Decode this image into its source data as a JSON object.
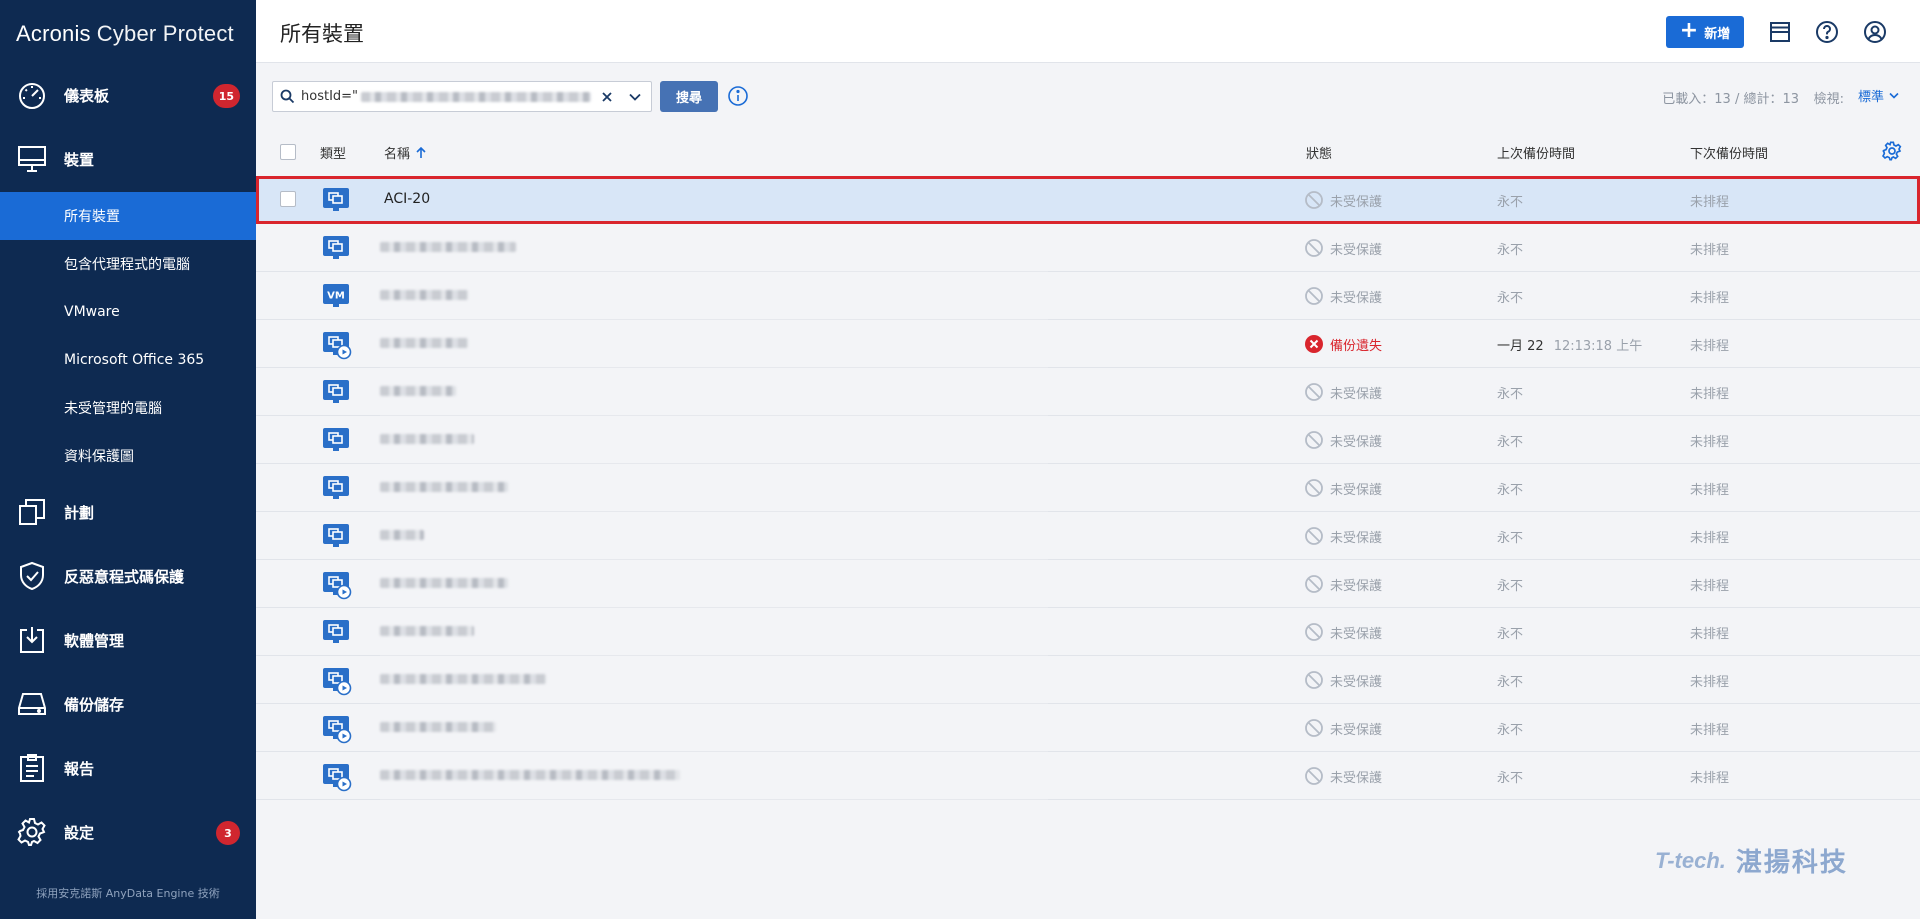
{
  "app": {
    "brand_primary": "Acronis",
    "brand_secondary": "Cyber Protect",
    "footer": "採用安克諾斯 AnyData Engine 技術"
  },
  "sidebar": {
    "main": [
      {
        "id": "dashboard",
        "label": "儀表板",
        "icon": "dashboard-gauge-icon",
        "badge": "15"
      },
      {
        "id": "devices",
        "label": "裝置",
        "icon": "monitor-icon"
      },
      {
        "id": "plans",
        "label": "計劃",
        "icon": "plans-icon"
      },
      {
        "id": "antimalware",
        "label": "反惡意程式碼保護",
        "icon": "shield-check-icon"
      },
      {
        "id": "software",
        "label": "軟體管理",
        "icon": "software-download-icon"
      },
      {
        "id": "storage",
        "label": "備份儲存",
        "icon": "storage-drive-icon"
      },
      {
        "id": "reports",
        "label": "報告",
        "icon": "report-clipboard-icon"
      },
      {
        "id": "settings",
        "label": "設定",
        "icon": "gear-icon",
        "badge": "3"
      }
    ],
    "sub": [
      {
        "label": "所有裝置",
        "active": true
      },
      {
        "label": "包含代理程式的電腦"
      },
      {
        "label": "VMware"
      },
      {
        "label": "Microsoft Office 365"
      },
      {
        "label": "未受管理的電腦"
      },
      {
        "label": "資料保護圖"
      }
    ]
  },
  "header": {
    "title": "所有裝置",
    "add_label": "新增",
    "icons": [
      "layout-toggle-icon",
      "help-icon",
      "user-account-icon"
    ]
  },
  "toolbar": {
    "search_value": "hostId=\"",
    "search_button": "搜尋",
    "loaded_text": "已載入：13 / 總計：13",
    "view_label": "檢視:",
    "view_value": "標準"
  },
  "table": {
    "columns": {
      "type": "類型",
      "name": "名稱",
      "status": "狀態",
      "last_backup": "上次備份時間",
      "next_backup": "下次備份時間"
    },
    "sort_column": "name",
    "sort_direction": "ascending",
    "rows": [
      {
        "type": "machine",
        "name": "ACI-20",
        "status": "未受保護",
        "status_kind": "unprotected",
        "last": "永不",
        "next": "未排程",
        "selected": true
      },
      {
        "type": "machine",
        "name": "",
        "status": "未受保護",
        "status_kind": "unprotected",
        "last": "永不",
        "next": "未排程"
      },
      {
        "type": "vm",
        "name": "",
        "status": "未受保護",
        "status_kind": "unprotected",
        "last": "永不",
        "next": "未排程"
      },
      {
        "type": "machine-agent",
        "name": "",
        "status": "備份遺失",
        "status_kind": "error",
        "last": "一月 22",
        "last_time": "12:13:18 上午",
        "next": "未排程"
      },
      {
        "type": "machine",
        "name": "",
        "status": "未受保護",
        "status_kind": "unprotected",
        "last": "永不",
        "next": "未排程"
      },
      {
        "type": "machine",
        "name": "",
        "status": "未受保護",
        "status_kind": "unprotected",
        "last": "永不",
        "next": "未排程"
      },
      {
        "type": "machine",
        "name": "",
        "status": "未受保護",
        "status_kind": "unprotected",
        "last": "永不",
        "next": "未排程"
      },
      {
        "type": "machine",
        "name": "",
        "status": "未受保護",
        "status_kind": "unprotected",
        "last": "永不",
        "next": "未排程"
      },
      {
        "type": "machine-agent",
        "name": "",
        "status": "未受保護",
        "status_kind": "unprotected",
        "last": "永不",
        "next": "未排程"
      },
      {
        "type": "machine",
        "name": "",
        "status": "未受保護",
        "status_kind": "unprotected",
        "last": "永不",
        "next": "未排程"
      },
      {
        "type": "machine-agent",
        "name": "",
        "status": "未受保護",
        "status_kind": "unprotected",
        "last": "永不",
        "next": "未排程"
      },
      {
        "type": "machine-agent",
        "name": "",
        "status": "未受保護",
        "status_kind": "unprotected",
        "last": "永不",
        "next": "未排程"
      },
      {
        "type": "machine-agent",
        "name": "",
        "status": "未受保護",
        "status_kind": "unprotected",
        "last": "永不",
        "next": "未排程"
      }
    ]
  },
  "watermark": {
    "logo": "T-tech.",
    "name": "湛揚科技"
  },
  "colors": {
    "sidebar_bg": "#0e2a51",
    "accent": "#1a6bd6",
    "badge": "#d0262f",
    "error": "#d9252d",
    "selected_row": "#d8e6f7"
  }
}
